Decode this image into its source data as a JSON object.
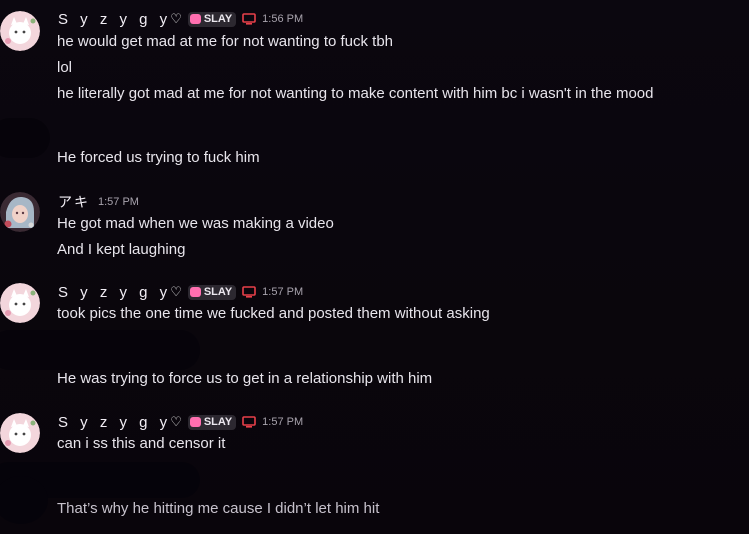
{
  "users": {
    "syzygy": {
      "name": "S y z y g y",
      "heart": "♡",
      "tag": "SLAY"
    },
    "aki": {
      "name": "アキ"
    }
  },
  "messages": [
    {
      "user": "Syzygy",
      "time": "1:56 PM",
      "lines": [
        "he would get mad at me for not wanting to fuck tbh",
        "lol",
        "he literally got mad at me for not wanting to make content with him bc i wasn't in the mood"
      ]
    },
    {
      "user": "hidden",
      "lines": [
        "He forced us trying to fuck him"
      ]
    },
    {
      "user": "アキ",
      "time": "1:57 PM",
      "lines": [
        "He got mad when we was making a video",
        "And I kept laughing"
      ]
    },
    {
      "user": "Syzygy",
      "time": "1:57 PM",
      "lines": [
        "took pics the one time we fucked and posted them without asking"
      ]
    },
    {
      "user": "hidden",
      "lines": [
        "He was trying to force us to get in a relationship with him"
      ]
    },
    {
      "user": "Syzygy",
      "time": "1:57 PM",
      "lines": [
        "can i ss this and censor it"
      ]
    },
    {
      "user": "hidden",
      "lines": [
        "That’s why he hitting me cause I didn’t let him hit"
      ]
    }
  ],
  "colors": {
    "background": "#0a060d",
    "tag_heart": "#ff6fb0",
    "desktop_icon": "#e8404a"
  },
  "icons": [
    "heart-outline-icon",
    "slay-heart-icon",
    "desktop-icon"
  ]
}
